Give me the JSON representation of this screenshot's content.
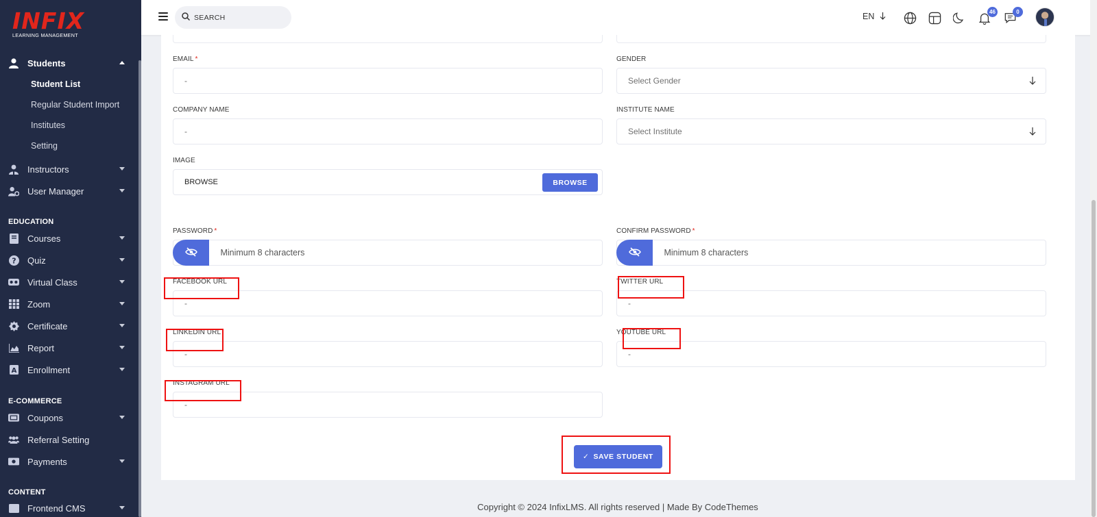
{
  "sidebar": {
    "logo": {
      "word": "INFIX",
      "subtitle": "LEARNING MANAGEMENT"
    },
    "items": [
      {
        "label": "Students",
        "icon": "user-icon",
        "expanded": true
      },
      {
        "label": "Instructors",
        "icon": "instructor-icon"
      },
      {
        "label": "User Manager",
        "icon": "user-cog-icon"
      },
      {
        "label": "Courses",
        "icon": "book-icon"
      },
      {
        "label": "Quiz",
        "icon": "question-circle-icon"
      },
      {
        "label": "Virtual Class",
        "icon": "vr-headset-icon"
      },
      {
        "label": "Zoom",
        "icon": "grid-icon"
      },
      {
        "label": "Certificate",
        "icon": "certificate-icon"
      },
      {
        "label": "Report",
        "icon": "chart-area-icon"
      },
      {
        "label": "Enrollment",
        "icon": "enrollment-icon"
      },
      {
        "label": "Coupons",
        "icon": "ticket-icon"
      },
      {
        "label": "Referral Setting",
        "icon": "users-icon"
      },
      {
        "label": "Payments",
        "icon": "money-icon"
      },
      {
        "label": "Frontend CMS",
        "icon": "cms-icon"
      }
    ],
    "student_sub": [
      "Student List",
      "Regular Student Import",
      "Institutes",
      "Setting"
    ],
    "sections": [
      "EDUCATION",
      "E-COMMERCE",
      "CONTENT"
    ]
  },
  "header": {
    "search_placeholder": "SEARCH",
    "language": "EN",
    "notification_count": "46",
    "message_count": "0"
  },
  "form": {
    "email": {
      "label": "EMAIL",
      "value": "-"
    },
    "gender": {
      "label": "GENDER",
      "value": "Select Gender"
    },
    "company": {
      "label": "COMPANY NAME",
      "value": "-"
    },
    "institute": {
      "label": "INSTITUTE NAME",
      "value": "Select Institute"
    },
    "image": {
      "label": "IMAGE",
      "value": "BROWSE",
      "button": "BROWSE"
    },
    "password": {
      "label": "PASSWORD",
      "placeholder": "Minimum 8 characters"
    },
    "confirm_password": {
      "label": "CONFIRM PASSWORD",
      "placeholder": "Minimum 8 characters"
    },
    "facebook": {
      "label": "FACEBOOK URL",
      "value": "-"
    },
    "twitter": {
      "label": "TWITTER URL",
      "value": "-"
    },
    "linkedin": {
      "label": "LINKEDIN URL",
      "value": "-"
    },
    "youtube": {
      "label": "YOUTUBE URL",
      "value": "-"
    },
    "instagram": {
      "label": "INSTAGRAM URL",
      "value": "-"
    },
    "required_mark": "*",
    "save_button": "SAVE STUDENT",
    "save_check": "✓"
  },
  "footer": {
    "text": "Copyright © 2024 InfixLMS. All rights reserved | Made By CodeThemes"
  },
  "colors": {
    "sidebar_bg": "#222b45",
    "accent": "#4f6bdb",
    "brand_red": "#e1261c",
    "highlight": "#ee1111"
  }
}
